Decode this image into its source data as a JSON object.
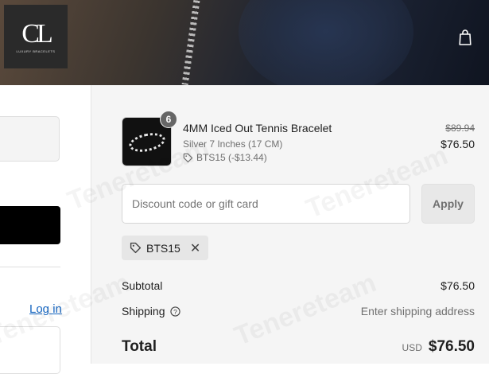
{
  "header": {
    "logo": {
      "mark": "CL",
      "tagline": "LUXURY BRACELETS"
    },
    "bag_icon": "shopping-bag-icon"
  },
  "left": {
    "login_link": "Log in"
  },
  "cart": {
    "item": {
      "quantity": "6",
      "name": "4MM Iced Out Tennis Bracelet",
      "variant": "Silver 7 Inches (17 CM)",
      "discount_tag": "BTS15 (-$13.44)",
      "original_price": "$89.94",
      "price": "$76.50"
    },
    "discount": {
      "placeholder": "Discount code or gift card",
      "apply_label": "Apply",
      "applied_code": "BTS15"
    },
    "summary": {
      "subtotal_label": "Subtotal",
      "subtotal_value": "$76.50",
      "shipping_label": "Shipping",
      "shipping_value": "Enter shipping address",
      "total_label": "Total",
      "currency": "USD",
      "total_value": "$76.50"
    }
  },
  "watermark": "Tenereteam"
}
